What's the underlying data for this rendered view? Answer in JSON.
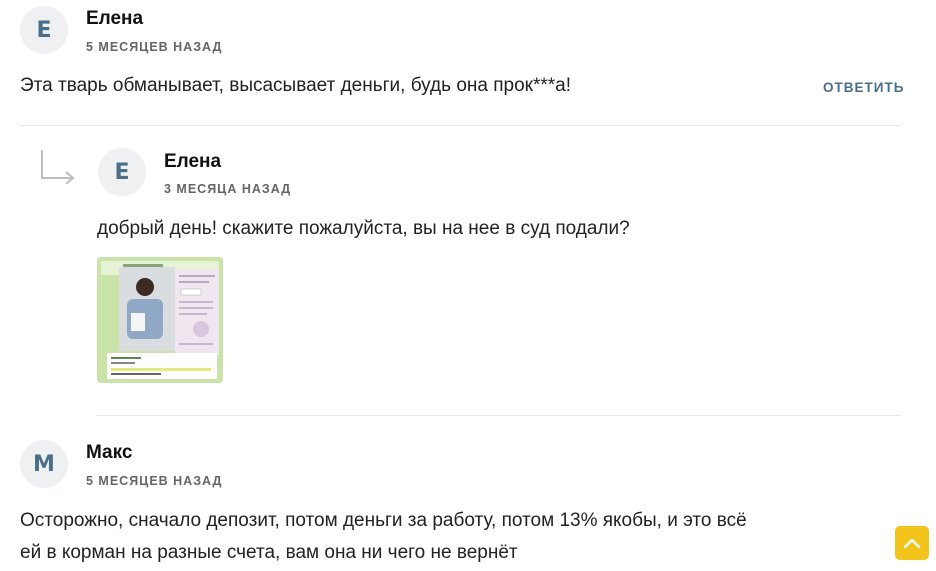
{
  "comments": [
    {
      "avatar_letter": "Е",
      "author": "Елена",
      "date": "5 МЕСЯЦЕВ НАЗАД",
      "text": "Эта тварь обманывает, высасывает деньги, будь она прок***а!",
      "reply_label": "ОТВЕТИТЬ"
    },
    {
      "avatar_letter": "Е",
      "author": "Елена",
      "date": "3 МЕСЯЦА НАЗАД",
      "text": "добрый день! скажите пожалуйста, вы на нее в суд подали?",
      "attachment_icon": "screenshot-image"
    },
    {
      "avatar_letter": "М",
      "author": "Макс",
      "date": "5 МЕСЯЦЕВ НАЗАД",
      "text_lines": [
        "Осторожно, сначало депозит, потом деньги за работу, потом 13% якобы, и это всё",
        "ей в корман на разные счета, вам она ни чего не вернёт"
      ]
    }
  ],
  "icons": {
    "reply_arrow": "reply-arrow-icon",
    "scroll_top": "chevron-up-icon"
  },
  "colors": {
    "accent": "#4a6f88",
    "scroll_button": "#f2c31a",
    "avatar_bg": "#eef0f2"
  }
}
